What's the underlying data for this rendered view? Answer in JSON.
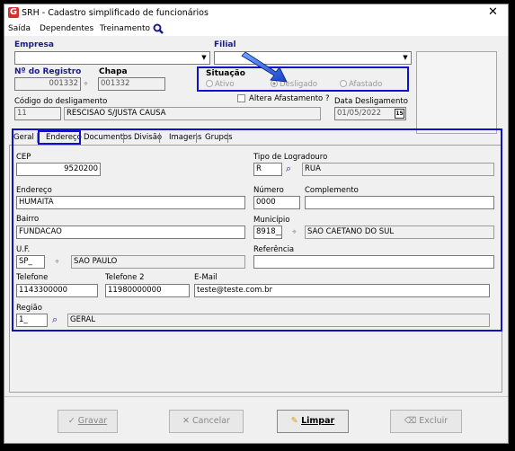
{
  "window": {
    "title": "SRH - Cadastro simplificado de funcionários",
    "close": "✕"
  },
  "menu": [
    "Saída",
    "Dependentes",
    "Treinamento"
  ],
  "empresa": {
    "label": "Empresa",
    "value": ""
  },
  "filial": {
    "label": "Filial",
    "value": ""
  },
  "registro": {
    "label": "Nº do Registro",
    "value": "001332"
  },
  "chapa": {
    "label": "Chapa",
    "value": "001332"
  },
  "situacao": {
    "label": "Situação",
    "options": [
      "Ativo",
      "Desligado",
      "Afastado"
    ],
    "selected": "Desligado"
  },
  "altera": {
    "label": "Altera Afastamento ?"
  },
  "desligamento": {
    "label": "Código do desligamento",
    "code": "11",
    "desc": "RESCISAO S/JUSTA CAUSA"
  },
  "data_deslig": {
    "label": "Data Desligamento",
    "value": "01/05/2022"
  },
  "tabs": [
    "Geral",
    "Endereço",
    "Documentos",
    "Divisão",
    "Imagens",
    "Grupos"
  ],
  "active_tab": "Endereço",
  "cep": {
    "label": "CEP",
    "value": "9520200"
  },
  "tipo_logradouro": {
    "label": "Tipo de Logradouro",
    "code": "R",
    "desc": "RUA"
  },
  "endereco": {
    "label": "Endereço",
    "value": "HUMAITA"
  },
  "numero": {
    "label": "Número",
    "value": "0000"
  },
  "complemento": {
    "label": "Complemento",
    "value": ""
  },
  "bairro": {
    "label": "Bairro",
    "value": "FUNDACAO"
  },
  "municipio": {
    "label": "Município",
    "code": "8918__",
    "desc": "SAO CAETANO DO SUL"
  },
  "uf": {
    "label": "U.F.",
    "code": "SP_",
    "desc": "SAO PAULO"
  },
  "referencia": {
    "label": "Referência",
    "value": ""
  },
  "telefone": {
    "label": "Telefone",
    "value": "1143300000"
  },
  "telefone2": {
    "label": "Telefone 2",
    "value": "11980000000"
  },
  "email": {
    "label": "E-Mail",
    "value": "teste@teste.com.br"
  },
  "regiao": {
    "label": "Região",
    "code": "1_",
    "desc": "GERAL"
  },
  "buttons": {
    "gravar": "Gravar",
    "cancelar": "Cancelar",
    "limpar": "Limpar",
    "excluir": "Excluir"
  },
  "colors": {
    "highlight": "#1010c8",
    "app_icon": "#d32f2f",
    "search_icon": "#1a1a8c"
  }
}
